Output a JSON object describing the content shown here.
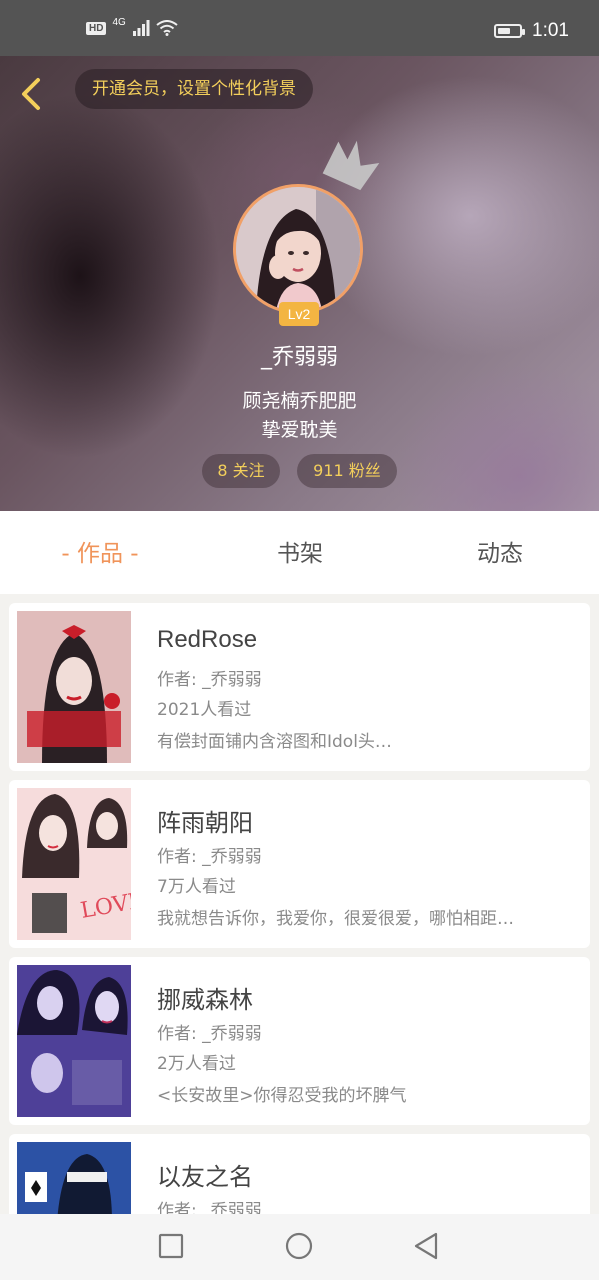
{
  "status_bar": {
    "hd": "HD",
    "network": "4G",
    "time": "1:01"
  },
  "header": {
    "vip_banner": "开通会员，设置个性化背景",
    "level": "Lv2",
    "username": "_乔弱弱",
    "bio_line1": "顾尧楠乔肥肥",
    "bio_line2": "挚爱耽美",
    "following": "8 关注",
    "followers": "911 粉丝"
  },
  "tabs": [
    "- 作品 -",
    "书架",
    "动态"
  ],
  "books": [
    {
      "title": "RedRose",
      "author": "作者: _乔弱弱",
      "views": "2021人看过",
      "desc": "有偿封面铺内含溶图和Idol头…"
    },
    {
      "title": "阵雨朝阳",
      "author": "作者: _乔弱弱",
      "views": "7万人看过",
      "desc": "我就想告诉你，我爱你，很爱很爱，哪怕相距…"
    },
    {
      "title": "挪威森林",
      "author": "作者: _乔弱弱",
      "views": "2万人看过",
      "desc": "<长安故里>你得忍受我的坏脾气"
    },
    {
      "title": "以友之名",
      "author": "作者: _乔弱弱",
      "views": "",
      "desc": ""
    }
  ],
  "icons": {
    "back": "chevron-left-icon",
    "crown": "crown-icon",
    "recents": "square-icon",
    "home": "circle-icon",
    "nav_back": "triangle-back-icon"
  },
  "colors": {
    "accent": "#f0945a",
    "gold": "#f3cf5b",
    "level_badge": "#f3b542"
  }
}
